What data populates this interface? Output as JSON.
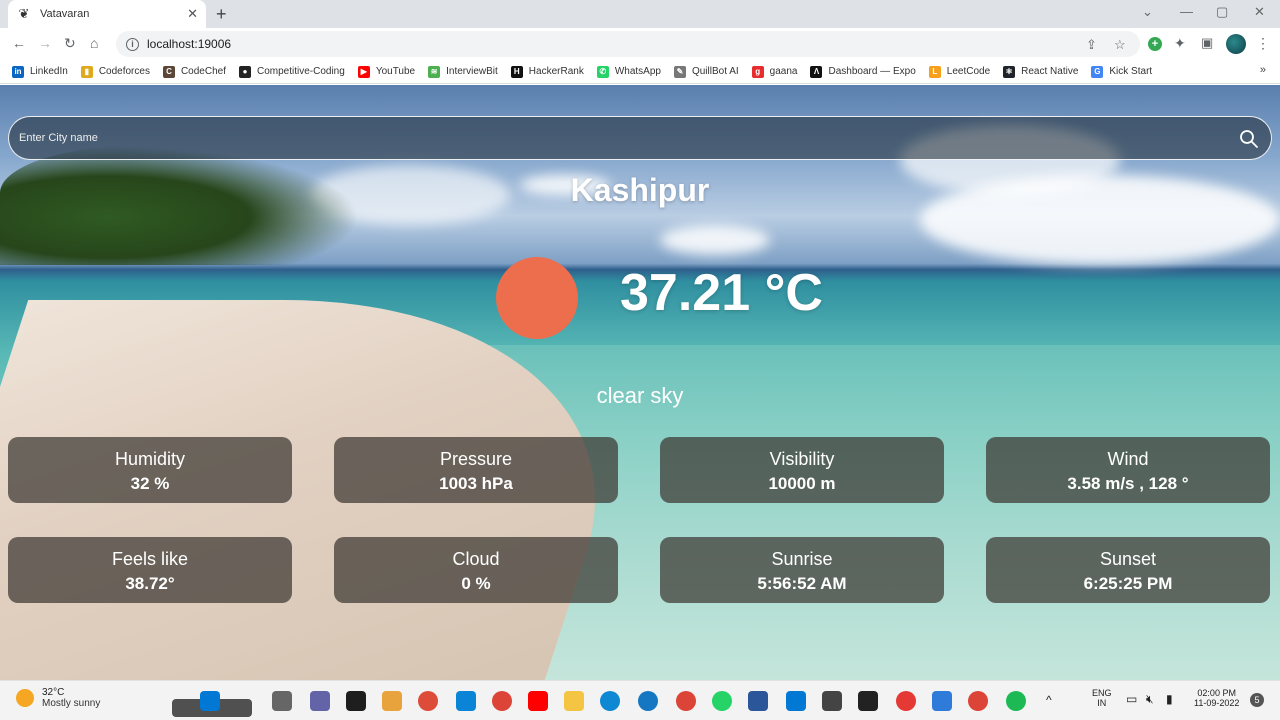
{
  "browser": {
    "tab_title": "Vatavaran",
    "url": "localhost:19006",
    "bookmarks": [
      {
        "label": "LinkedIn",
        "color": "#0a66c2",
        "glyph": "in"
      },
      {
        "label": "Codeforces",
        "color": "#e0a81c",
        "glyph": "▮"
      },
      {
        "label": "CodeChef",
        "color": "#5b4638",
        "glyph": "C"
      },
      {
        "label": "Competitive-Coding",
        "color": "#222222",
        "glyph": "●"
      },
      {
        "label": "YouTube",
        "color": "#ff0000",
        "glyph": "▶"
      },
      {
        "label": "InterviewBit",
        "color": "#4caf50",
        "glyph": "≋"
      },
      {
        "label": "HackerRank",
        "color": "#111111",
        "glyph": "H"
      },
      {
        "label": "WhatsApp",
        "color": "#25d366",
        "glyph": "✆"
      },
      {
        "label": "QuillBot AI",
        "color": "#777777",
        "glyph": "✎"
      },
      {
        "label": "gaana",
        "color": "#e72c30",
        "glyph": "g"
      },
      {
        "label": "Dashboard — Expo",
        "color": "#111111",
        "glyph": "Λ"
      },
      {
        "label": "LeetCode",
        "color": "#f89f1b",
        "glyph": "L"
      },
      {
        "label": "React Native",
        "color": "#20232a",
        "glyph": "⚛"
      },
      {
        "label": "Kick Start",
        "color": "#4285f4",
        "glyph": "G"
      }
    ]
  },
  "app": {
    "search_placeholder": "Enter City name",
    "city": "Kashipur",
    "temperature": "37.21 °C",
    "description": "clear sky",
    "stats": [
      {
        "label": "Humidity",
        "value": "32 %"
      },
      {
        "label": "Pressure",
        "value": "1003 hPa"
      },
      {
        "label": "Visibility",
        "value": "10000 m"
      },
      {
        "label": "Wind",
        "value": "3.58 m/s , 128 °"
      },
      {
        "label": "Feels like",
        "value": "38.72°"
      },
      {
        "label": "Cloud",
        "value": "0 %"
      },
      {
        "label": "Sunrise",
        "value": "5:56:52 AM"
      },
      {
        "label": "Sunset",
        "value": "6:25:25 PM"
      }
    ]
  },
  "taskbar": {
    "weather_temp": "32°C",
    "weather_desc": "Mostly sunny",
    "lang_1": "ENG",
    "lang_2": "IN",
    "time": "02:00 PM",
    "date": "11-09-2022",
    "notification_count": "5"
  },
  "colors": {
    "sun": "#ec6e4d",
    "card_bg": "rgba(60,55,50,0.72)"
  }
}
